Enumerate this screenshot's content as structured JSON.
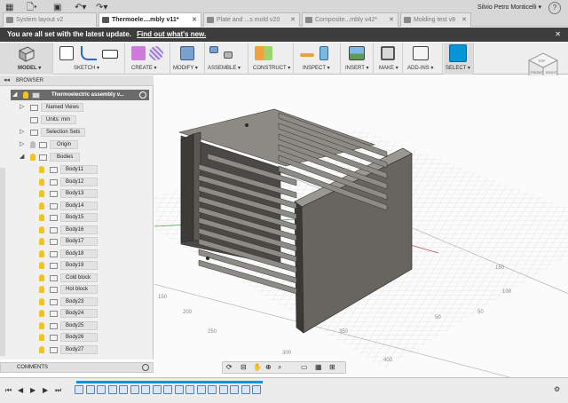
{
  "tabs": [
    {
      "label": "System layout v2",
      "active": false
    },
    {
      "label": "Thermoele....mbly v11*",
      "active": true
    },
    {
      "label": "Plate and ...s mold v20",
      "active": false
    },
    {
      "label": "Composite...mbly v42*",
      "active": false
    },
    {
      "label": "Molding test v8",
      "active": false
    }
  ],
  "user": "Silvio Petro Monticelli ▾",
  "help_label": "?",
  "notice": {
    "text": "You are all set with the latest update.",
    "link": "Find out what's new.",
    "close": "✕"
  },
  "toolbar": {
    "model": "MODEL ▾",
    "groups": [
      {
        "label": "SKETCH ▾"
      },
      {
        "label": "CREATE ▾"
      },
      {
        "label": "MODIFY ▾"
      },
      {
        "label": "ASSEMBLE ▾"
      },
      {
        "label": "CONSTRUCT ▾"
      },
      {
        "label": "INSPECT ▾"
      },
      {
        "label": "INSERT ▾"
      },
      {
        "label": "MAKE ▾"
      },
      {
        "label": "ADD-INS ▾"
      },
      {
        "label": "SELECT ▾"
      }
    ]
  },
  "viewcube": {
    "top": "TOP",
    "front": "FRONT",
    "right": "RIGHT"
  },
  "browser": {
    "title": "BROWSER",
    "root": "Thermoelectric assembly v...",
    "items": [
      {
        "label": "Named Views"
      },
      {
        "label": "Units: mm"
      },
      {
        "label": "Selection Sets"
      },
      {
        "label": "Origin"
      },
      {
        "label": "Bodies"
      }
    ],
    "bodies": [
      "Body11",
      "Body12",
      "Body13",
      "Body14",
      "Body15",
      "Body16",
      "Body17",
      "Body18",
      "Body19",
      "Cold block",
      "Hot block",
      "Body23",
      "Body24",
      "Body25",
      "Body26",
      "Body27"
    ]
  },
  "comments_label": "COMMENTS",
  "grid_labels": {
    "right": [
      "150",
      "100",
      "50",
      "50"
    ],
    "front": [
      "150",
      "200",
      "250",
      "300",
      "350",
      "400"
    ]
  },
  "colors": {
    "accent": "#0696d7",
    "body": "#5f5d58",
    "bulb": "#f0c419"
  }
}
